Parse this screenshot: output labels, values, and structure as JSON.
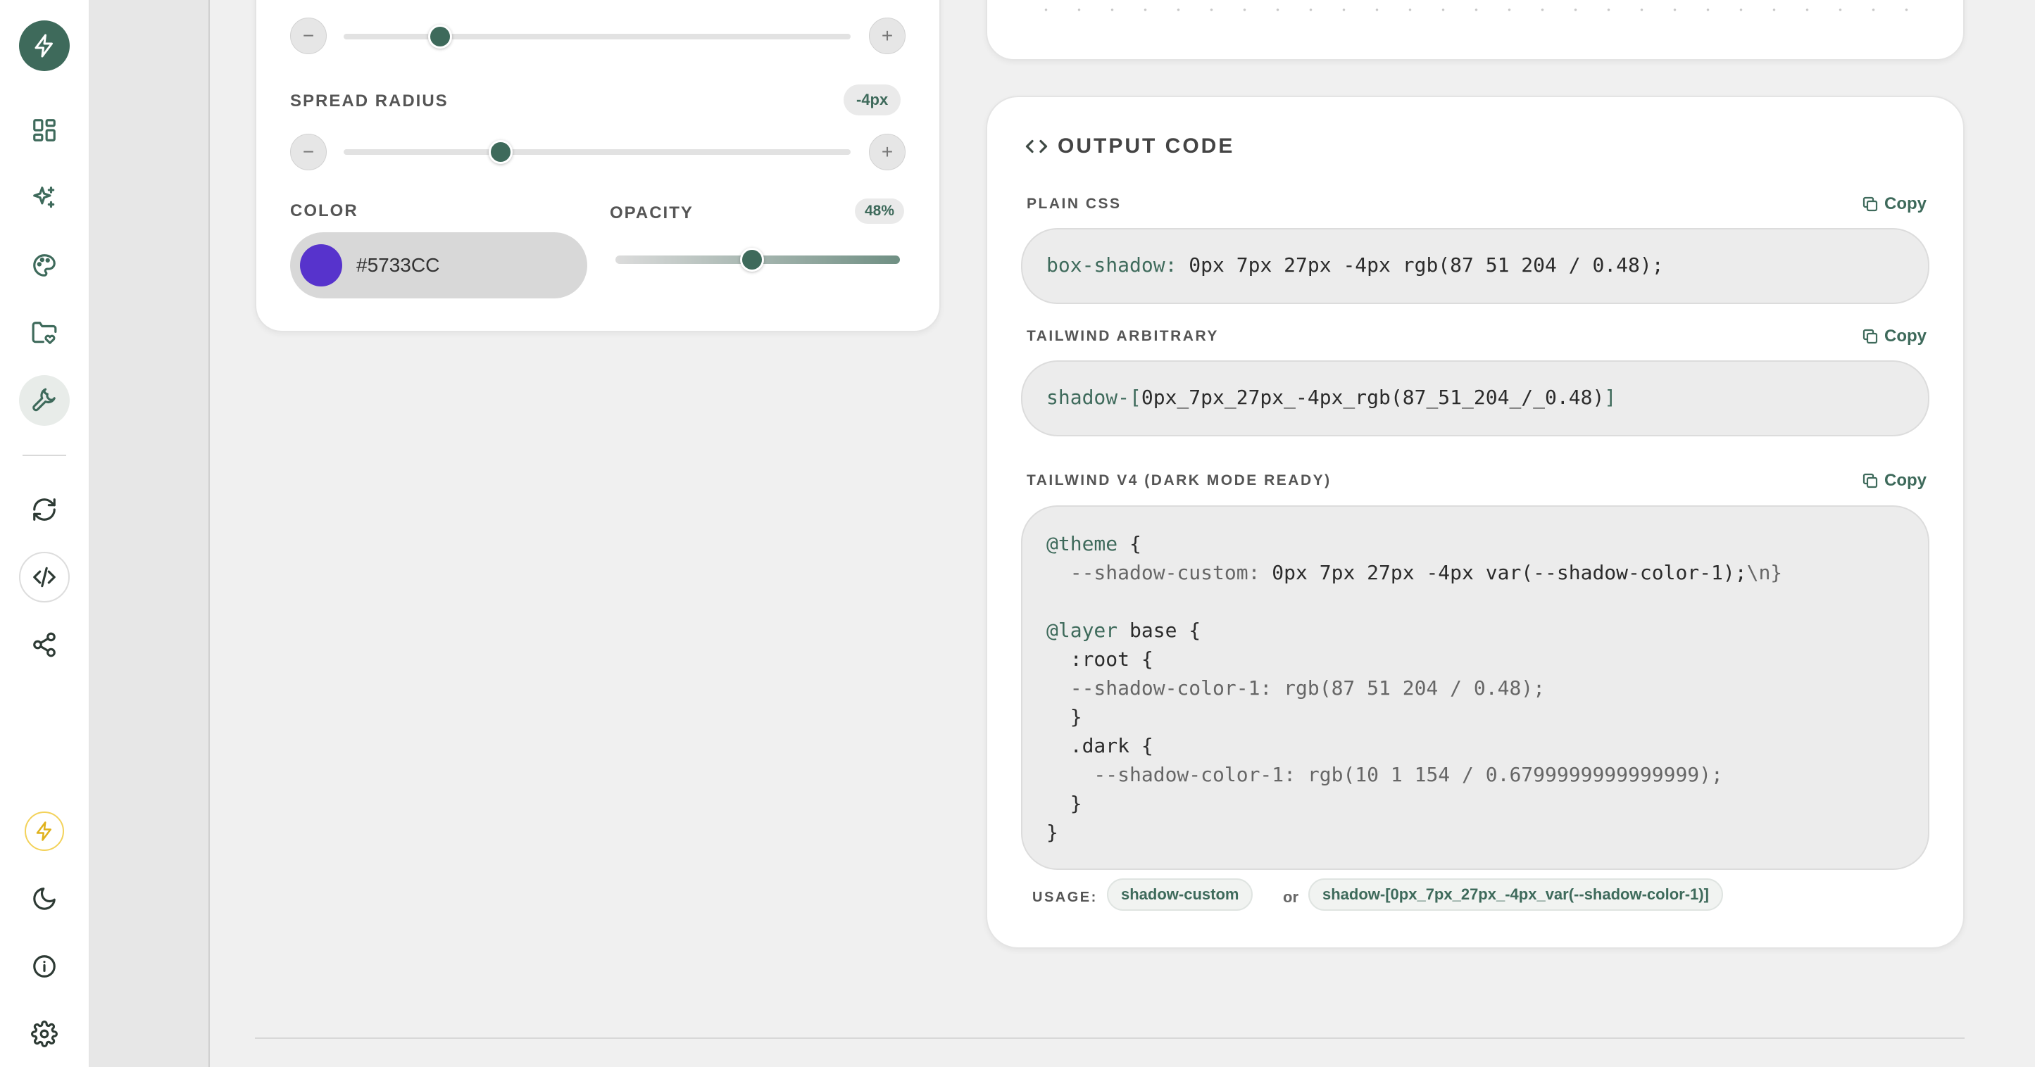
{
  "sidebar": {
    "items": [
      {
        "name": "logo",
        "icon": "bolt-icon"
      },
      {
        "name": "dashboard",
        "icon": "grid-icon"
      },
      {
        "name": "effects",
        "icon": "sparkles-icon"
      },
      {
        "name": "palette",
        "icon": "palette-icon"
      },
      {
        "name": "saved",
        "icon": "folder-heart-icon"
      },
      {
        "name": "tools",
        "icon": "wrench-icon",
        "active": true
      },
      {
        "name": "refresh",
        "icon": "refresh-icon"
      },
      {
        "name": "code",
        "icon": "code-icon"
      },
      {
        "name": "share",
        "icon": "share-icon"
      },
      {
        "name": "pro",
        "icon": "bolt-icon"
      },
      {
        "name": "theme",
        "icon": "moon-icon"
      },
      {
        "name": "info",
        "icon": "info-icon"
      },
      {
        "name": "settings",
        "icon": "gear-icon"
      }
    ]
  },
  "controls": {
    "blur_slider_fraction": 0.19,
    "spread": {
      "label": "SPREAD RADIUS",
      "value": "-4px",
      "slider_fraction": 0.31
    },
    "color": {
      "label": "COLOR",
      "value": "#5733CC",
      "swatch": "#5733CC"
    },
    "opacity": {
      "label": "OPACITY",
      "value": "48%",
      "slider_fraction": 0.48
    }
  },
  "output": {
    "title": "OUTPUT CODE",
    "copy_label": "Copy",
    "plain_css": {
      "label": "PLAIN CSS",
      "property": "box-shadow:",
      "value": " 0px 7px 27px -4px rgb(87 51 204 / 0.48);"
    },
    "tailwind_arbitrary": {
      "label": "TAILWIND ARBITRARY",
      "prefix": "shadow-[",
      "value": "0px_7px_27px_-4px_rgb(87_51_204_/_0.48)",
      "suffix": "]"
    },
    "tailwind_v4": {
      "label": "TAILWIND V4 (DARK MODE READY)",
      "line1_kw": "@theme",
      "line1_rest": " {",
      "line2_var": "  --shadow-custom:",
      "line2_val": " 0px 7px 27px -4px var(--shadow-color-1);",
      "line2_tail": "\\n}",
      "line4_kw": "@layer",
      "line4_rest": " base {",
      "line5": "  :root {",
      "line6": "  --shadow-color-1: rgb(87 51 204 / 0.48);",
      "line7": "  }",
      "line8": "  .dark {",
      "line9": "    --shadow-color-1: rgb(10 1 154 / 0.6799999999999999);",
      "line10": "  }",
      "line11": "}"
    },
    "usage": {
      "label": "USAGE:",
      "chip1": "shadow-custom",
      "or": "or",
      "chip2": "shadow-[0px_7px_27px_-4px_var(--shadow-color-1)]"
    }
  },
  "colors": {
    "accent": "#3e6a5b",
    "pro": "#e0b21c"
  }
}
